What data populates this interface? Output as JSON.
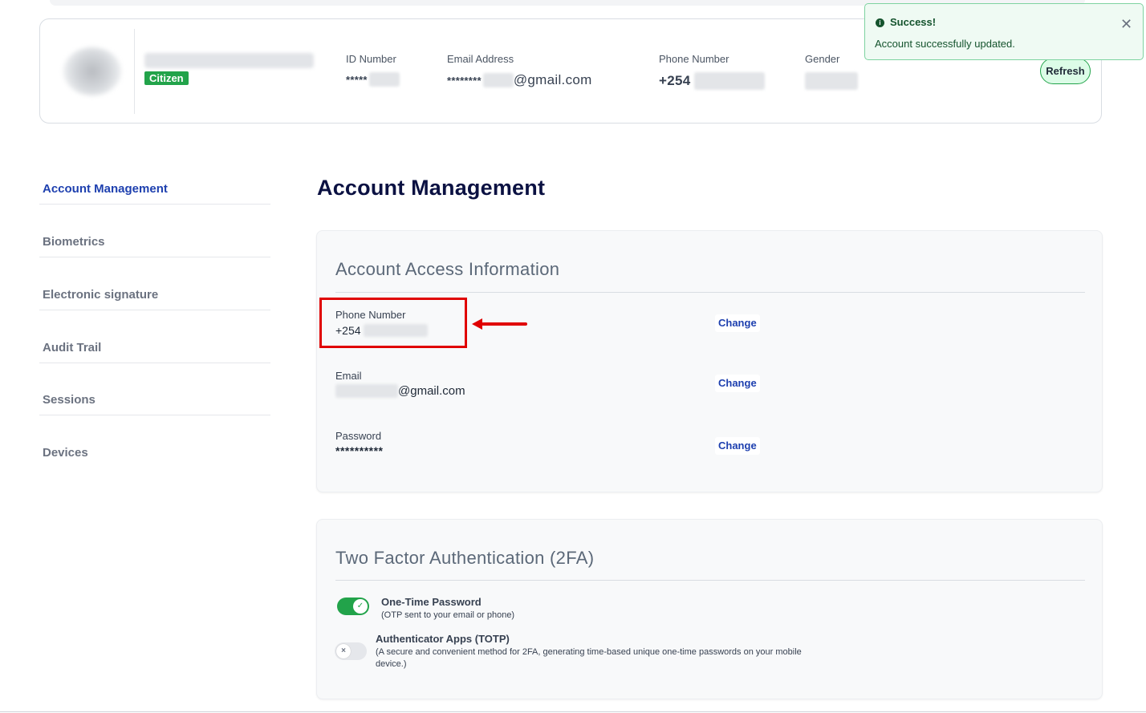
{
  "profile": {
    "badge": "Citizen",
    "id_number": {
      "label": "ID Number",
      "value": "*****"
    },
    "email": {
      "label": "Email Address",
      "value_prefix": "********",
      "value_suffix": "@gmail.com"
    },
    "phone": {
      "label": "Phone Number",
      "value": "+254"
    },
    "gender": {
      "label": "Gender"
    },
    "refresh_label": "Refresh"
  },
  "toast": {
    "title": "Success!",
    "message": "Account successfully updated.",
    "close_glyph": "✕"
  },
  "sidebar": {
    "items": [
      {
        "label": "Account Management",
        "active": true
      },
      {
        "label": "Biometrics"
      },
      {
        "label": "Electronic signature"
      },
      {
        "label": "Audit Trail"
      },
      {
        "label": "Sessions"
      },
      {
        "label": "Devices"
      }
    ]
  },
  "main": {
    "title": "Account Management",
    "access": {
      "title": "Account Access Information",
      "phone": {
        "label": "Phone Number",
        "value": "+254",
        "change": "Change"
      },
      "email": {
        "label": "Email",
        "value_suffix": "@gmail.com",
        "change": "Change"
      },
      "password": {
        "label": "Password",
        "value": "**********",
        "change": "Change"
      }
    },
    "twofa": {
      "title": "Two Factor Authentication (2FA)",
      "otp": {
        "title": "One-Time Password",
        "desc": "(OTP sent to your email or phone)",
        "enabled": true
      },
      "totp": {
        "title": "Authenticator Apps (TOTP)",
        "desc": "(A secure and convenient method for 2FA, generating time-based unique one-time passwords on your mobile device.)",
        "enabled": false
      }
    }
  },
  "icons": {
    "info": "info-circle-icon",
    "close": "close-icon",
    "check": "check-icon",
    "x": "x-icon"
  },
  "colors": {
    "accent_blue": "#1e40af",
    "success_green": "#22a34a",
    "highlight_red": "#e00000"
  }
}
